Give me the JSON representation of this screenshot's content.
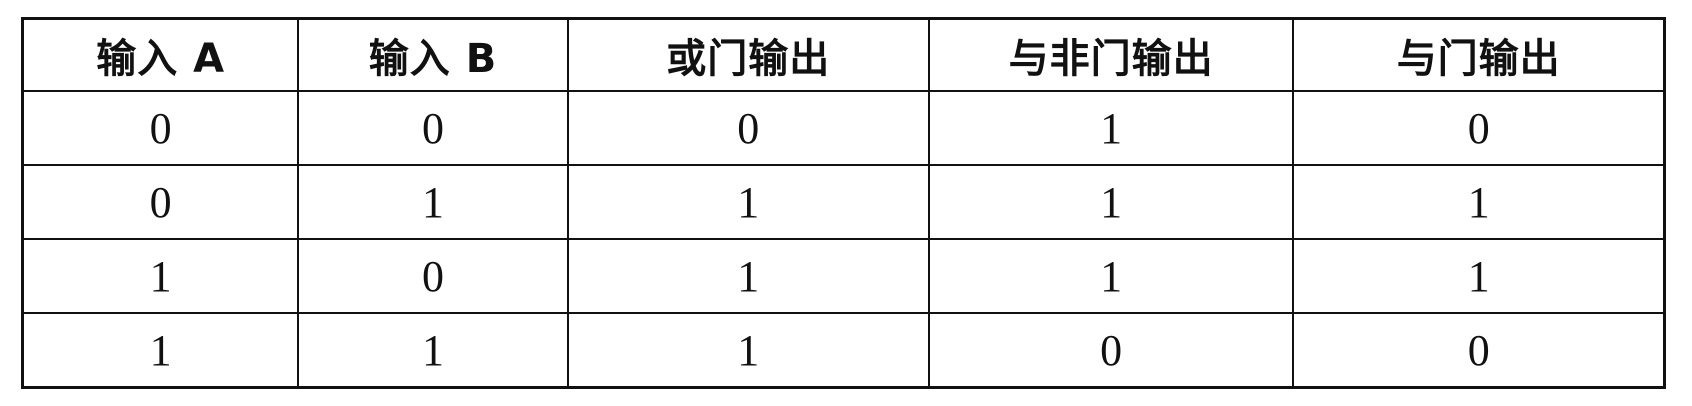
{
  "table": {
    "headers": [
      "输入 A",
      "输入 B",
      "或门输出",
      "与非门输出",
      "与门输出"
    ],
    "rows": [
      [
        "0",
        "0",
        "0",
        "1",
        "0"
      ],
      [
        "0",
        "1",
        "1",
        "1",
        "1"
      ],
      [
        "1",
        "0",
        "1",
        "1",
        "1"
      ],
      [
        "1",
        "1",
        "1",
        "0",
        "0"
      ]
    ]
  }
}
